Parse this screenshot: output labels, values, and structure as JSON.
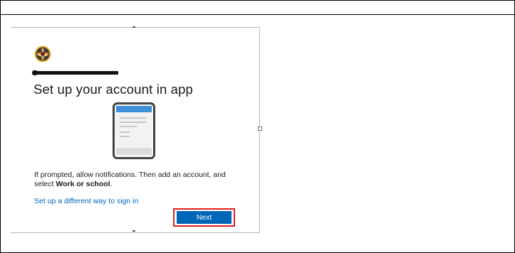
{
  "dialog": {
    "title": "Set up your account in app",
    "description_prefix": "If prompted, allow notifications. Then add an account, and select ",
    "description_bold": "Work or school",
    "description_suffix": ".",
    "alternate_link": "Set up a different way to sign in",
    "next_button": "Next"
  },
  "colors": {
    "accent": "#0067b8",
    "highlight": "#e02020",
    "phone_header": "#3f8fdb",
    "phone_body": "#f2f2f2"
  },
  "icons": {
    "logo": "organization-logo-icon",
    "phone": "authenticator-phone-icon"
  }
}
